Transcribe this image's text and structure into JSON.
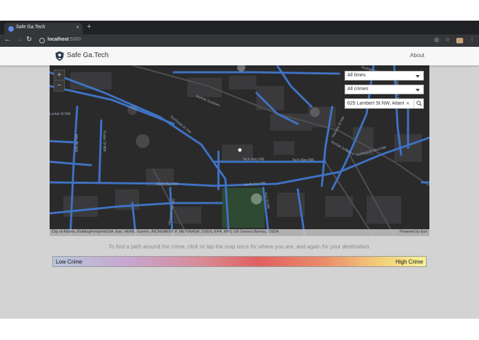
{
  "browser": {
    "tab_title": "Safe Ga.Tech",
    "tab_close": "×",
    "new_tab": "+",
    "url_host": "localhost",
    "url_port": ":5000"
  },
  "app": {
    "brand": "Safe Ga.Tech",
    "nav_about": "About"
  },
  "map": {
    "zoom_in": "+",
    "zoom_out": "−",
    "time_filter": "All times",
    "crime_filter": "All crimes",
    "search_value": "625 Lambert St NW, Atlanta",
    "street_labels": [
      "Norfolk Southern",
      "Tech Way NW",
      "Tech Way NW",
      "North Ave NW",
      "North Ave NW",
      "Northside Dr NW",
      "Marietta St NW",
      "Norfolk Southern",
      "Luckie St NW",
      "Mills St NW",
      "Foster St NW",
      "Northyards Blvd NW",
      "Norfolk Southern",
      "Lambert St NW",
      "Fox St NW",
      "Hemphill Ave NW"
    ],
    "attribution": "City of Atlanta, BuildingFootprintUSA, Esri, HERE, Garmin, INCREMENT P, METI/NASA, USGS, EPA, NPS, US Census Bureau, USDA",
    "powered_by": "Powered by Esri"
  },
  "instructions": "To find a path around the crime, click or tap the map once for where you are, and again for your destination.",
  "legend": {
    "low": "Low Crime",
    "high": "High Crime"
  },
  "colors": {
    "road": "#3f72c4",
    "map_bg": "#2a2a2a",
    "page_bg": "#d3d3d3"
  }
}
